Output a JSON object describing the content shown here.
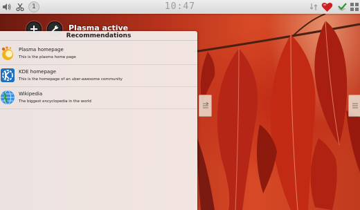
{
  "status_bar": {
    "clock": "10:47",
    "notification_count": "1"
  },
  "activity": {
    "name": "Plasma active"
  },
  "recommendations": {
    "title": "Recommendations",
    "items": [
      {
        "title": "Plasma homepage",
        "description": "This is the plasma home page",
        "icon": "plasma-icon"
      },
      {
        "title": "KDE homepage",
        "description": "This is the homepage of an uber-awesome community",
        "icon": "kde-icon"
      },
      {
        "title": "Wikipedia",
        "description": "The biggest encyclopedia in the world",
        "icon": "globe-icon"
      }
    ]
  },
  "colors": {
    "accent_red": "#cc2020",
    "panel_background": "#f6f4f2",
    "wallpaper_red": "#c03a1e"
  }
}
